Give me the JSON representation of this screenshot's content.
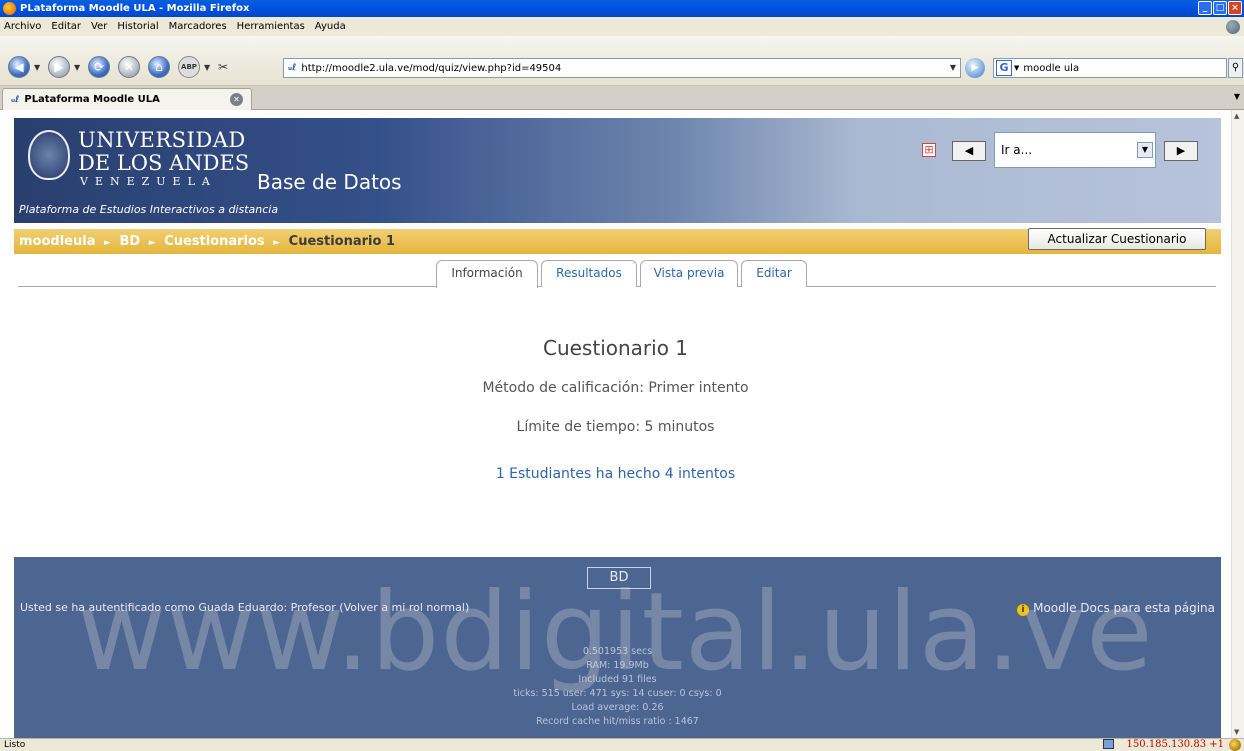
{
  "window": {
    "title": "PLataforma Moodle ULA - Mozilla Firefox",
    "controls": [
      "_",
      "□",
      "×"
    ]
  },
  "menu": [
    "Archivo",
    "Editar",
    "Ver",
    "Historial",
    "Marcadores",
    "Herramientas",
    "Ayuda"
  ],
  "toolbar": {
    "url": "http://moodle2.ula.ve/mod/quiz/view.php?id=49504",
    "search_value": "moodle ula",
    "abp_label": "ABP",
    "search_engine_glyph": "G"
  },
  "tabs": [
    {
      "label": "PLataforma Moodle ULA"
    }
  ],
  "header": {
    "uni_line1": "UNIVERSIDAD",
    "uni_line2": "DE LOS ANDES",
    "uni_line3": "VENEZUELA",
    "course": "Base de Datos",
    "tagline": "Plataforma de Estudios Interactivos a distancia",
    "jump_value": "Ir a..."
  },
  "breadcrumb": {
    "items": [
      "moodleula",
      "BD",
      "Cuestionarios"
    ],
    "current": "Cuestionario 1",
    "separator": "►"
  },
  "update_button": "Actualizar Cuestionario",
  "module_tabs": [
    {
      "label": "Información",
      "active": true
    },
    {
      "label": "Resultados",
      "active": false
    },
    {
      "label": "Vista previa",
      "active": false
    },
    {
      "label": "Editar",
      "active": false
    }
  ],
  "quiz": {
    "title": "Cuestionario 1",
    "method": "Método de calificación: Primer intento",
    "time_limit": "Límite de tiempo: 5 minutos",
    "attempts": "1 Estudiantes ha hecho 4 intentos"
  },
  "footer": {
    "course_short": "BD",
    "login_prefix": "Usted se ha autentificado como ",
    "user": "Guada Eduardo",
    "role": ": Profesor (",
    "return_role": "Volver a mi rol normal",
    "role_close": ")",
    "docs": "Moodle Docs para esta página",
    "perf": [
      "0.501953 secs",
      "RAM: 19.9Mb",
      "Included 91 files",
      "ticks: 515 user: 471 sys: 14 cuser: 0 csys: 0",
      "Load average: 0.26",
      "Record cache hit/miss ratio : 1467"
    ]
  },
  "watermark": "www.bdigital.ula.ve",
  "status": {
    "text": "Listo",
    "ip": "150.185.130.83 +1"
  },
  "colors": {
    "banner": "#34508a",
    "breadcrumb_bar": "#e5b63d",
    "footer": "#4c6591",
    "link": "#2b66a8"
  }
}
